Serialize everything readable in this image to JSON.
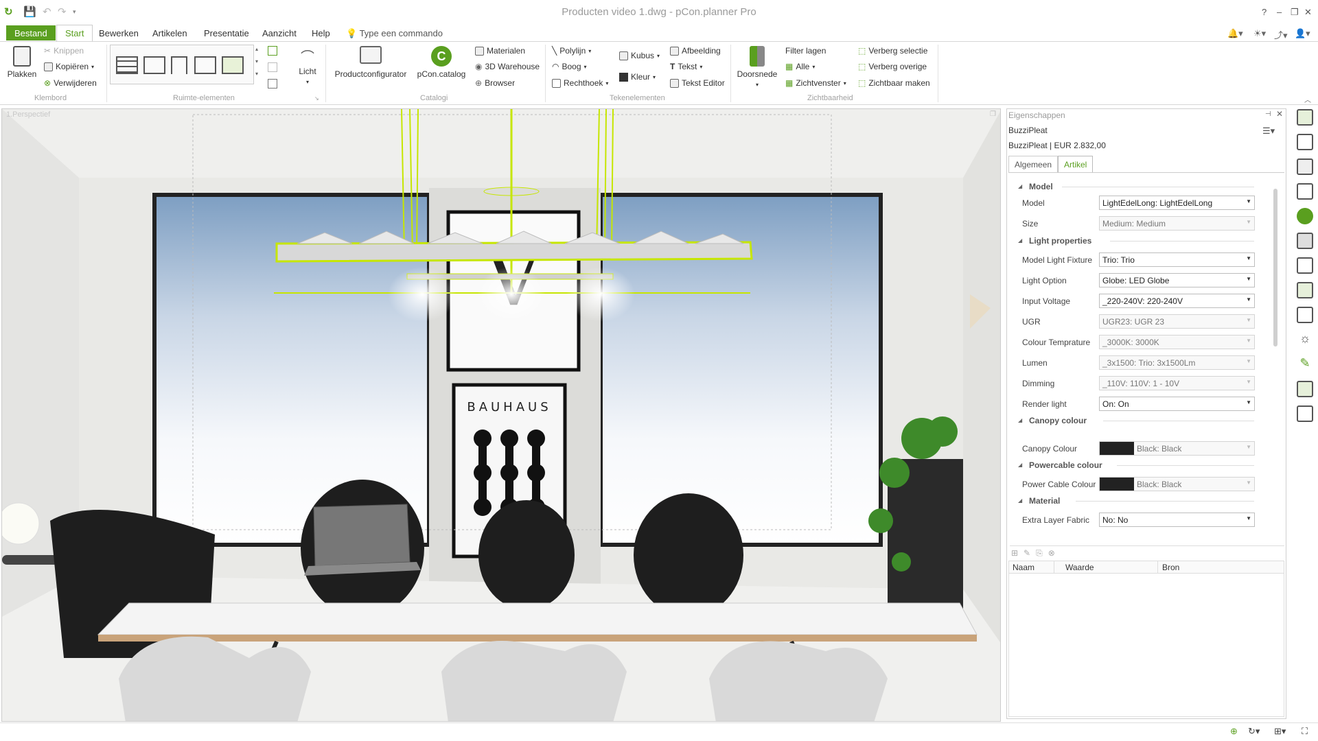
{
  "window": {
    "title": "Producten video 1.dwg - pCon.planner Pro"
  },
  "menubar": {
    "items": [
      "Bestand",
      "Start",
      "Bewerken",
      "Artikelen",
      "Presentatie",
      "Aanzicht",
      "Help"
    ],
    "command_placeholder": "Type een commando"
  },
  "ribbon": {
    "klembord": {
      "paste": "Plakken",
      "cut": "Knippen",
      "copy": "Kopiëren",
      "delete": "Verwijderen",
      "label": "Klembord"
    },
    "ruimte": {
      "label": "Ruimte-elementen",
      "light": "Licht"
    },
    "catalogi": {
      "productconfigurator": "Productconfigurator",
      "pcon_catalog": "pCon.catalog",
      "materialen": "Materialen",
      "warehouse": "3D Warehouse",
      "browser": "Browser",
      "label": "Catalogi"
    },
    "tekenelementen": {
      "polylijn": "Polylijn",
      "boog": "Boog",
      "rechthoek": "Rechthoek",
      "kubus": "Kubus",
      "kleur": "Kleur",
      "afbeelding": "Afbeelding",
      "tekst": "Tekst",
      "tekst_editor": "Tekst Editor",
      "label": "Tekenelementen"
    },
    "zichtbaarheid": {
      "doorsnede": "Doorsnede",
      "filter": "Filter lagen",
      "alle": "Alle",
      "zichtvenster": "Zichtvenster",
      "verberg_selectie": "Verberg selectie",
      "verberg_overige": "Verberg overige",
      "zichtbaar_maken": "Zichtbaar maken",
      "label": "Zichtbaarheid"
    }
  },
  "viewport": {
    "label": "1.Perspectief"
  },
  "properties": {
    "header": "Eigenschappen",
    "object_name": "BuzziPleat",
    "object_price": "BuzziPleat | EUR 2.832,00",
    "tabs": [
      "Algemeen",
      "Artikel"
    ],
    "active_tab": "Artikel",
    "sections": {
      "model": "Model",
      "light": "Light properties",
      "canopy": "Canopy colour",
      "powercable": "Powercable colour",
      "material": "Material"
    },
    "rows": [
      {
        "label": "Model",
        "value": "LightEdelLong: LightEdelLong",
        "readonly": false
      },
      {
        "label": "Size",
        "value": "Medium: Medium",
        "readonly": true
      },
      {
        "label": "Model Light Fixture",
        "value": "Trio: Trio",
        "readonly": false
      },
      {
        "label": "Light Option",
        "value": "Globe: LED Globe",
        "readonly": false
      },
      {
        "label": "Input Voltage",
        "value": "_220-240V: 220-240V",
        "readonly": false
      },
      {
        "label": "UGR",
        "value": "UGR23: UGR 23",
        "readonly": true
      },
      {
        "label": "Colour Temprature",
        "value": "_3000K: 3000K",
        "readonly": true
      },
      {
        "label": "Lumen",
        "value": "_3x1500: Trio: 3x1500Lm",
        "readonly": true
      },
      {
        "label": "Dimming",
        "value": "_110V: 110V: 1 - 10V",
        "readonly": true
      },
      {
        "label": "Render light",
        "value": "On: On",
        "readonly": false
      },
      {
        "label": "Canopy Colour",
        "value": "Black: Black",
        "readonly": true
      },
      {
        "label": "Power Cable Colour",
        "value": "Black: Black",
        "readonly": true
      },
      {
        "label": "Extra Layer Fabric",
        "value": "No: No",
        "readonly": false
      }
    ],
    "table_headers": [
      "Naam",
      "Waarde",
      "Bron"
    ]
  },
  "scene": {
    "poster_text": "BAUHAUS"
  },
  "colors": {
    "accent": "#5a9f1f",
    "selection": "#c6e600"
  }
}
